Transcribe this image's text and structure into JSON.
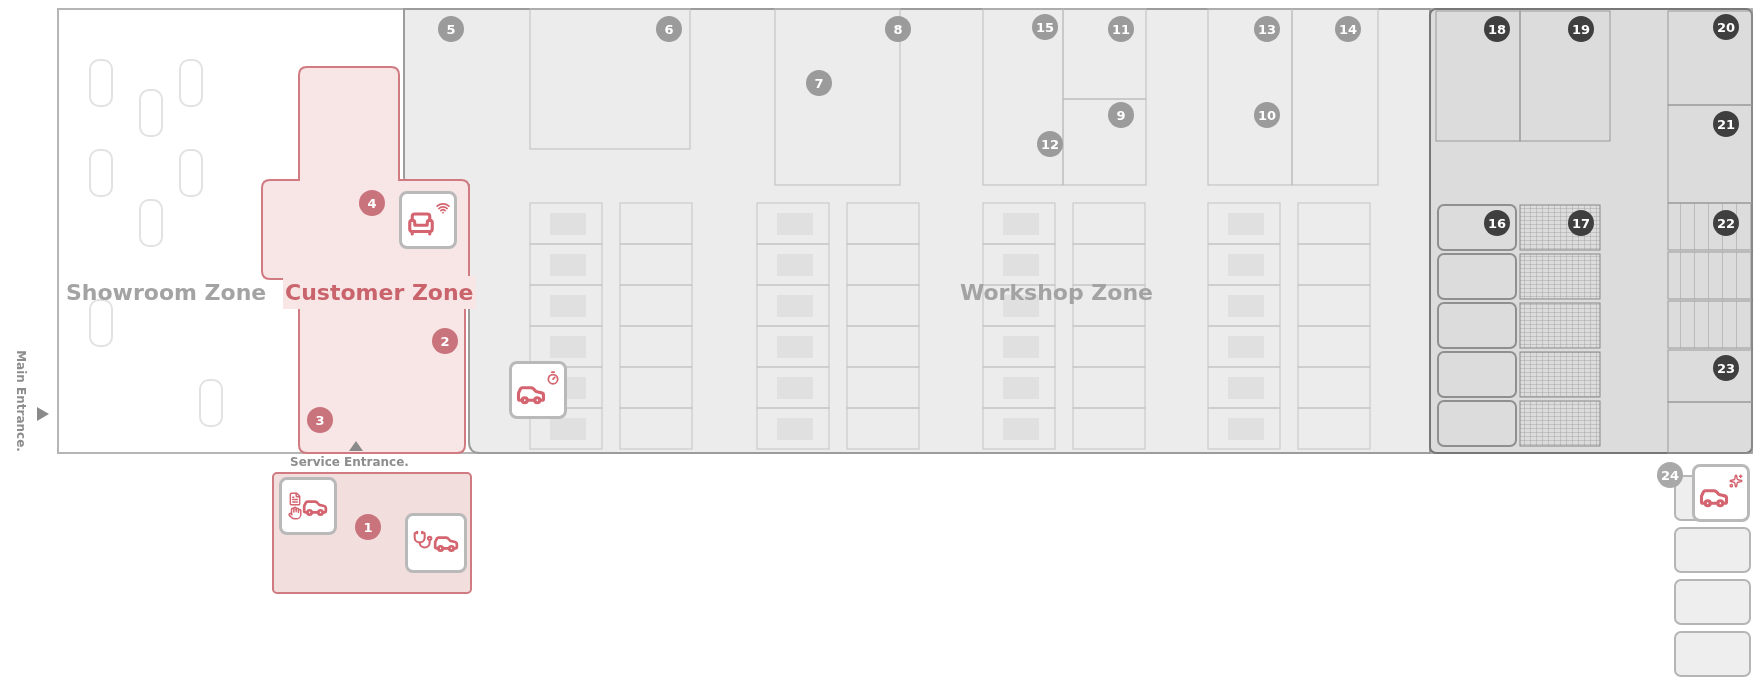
{
  "zones": [
    {
      "kind": "showroom",
      "label": "Showroom Zone"
    },
    {
      "kind": "customer",
      "label": "Customer Zone"
    },
    {
      "kind": "workshop",
      "label": "Workshop Zone"
    }
  ],
  "entrances": [
    {
      "kind": "main",
      "label": "Main Entrance."
    },
    {
      "kind": "service",
      "label": "Service Entrance."
    }
  ],
  "markers": [
    {
      "number": "5",
      "color": "#9b9b9b"
    },
    {
      "number": "6",
      "color": "#9b9b9b"
    },
    {
      "number": "8",
      "color": "#9b9b9b"
    },
    {
      "number": "15",
      "color": "#9b9b9b"
    },
    {
      "number": "11",
      "color": "#9b9b9b"
    },
    {
      "number": "13",
      "color": "#9b9b9b"
    },
    {
      "number": "14",
      "color": "#9b9b9b"
    },
    {
      "number": "18",
      "color": "#3f3f40"
    },
    {
      "number": "19",
      "color": "#3f3f40"
    },
    {
      "number": "20",
      "color": "#3f3f40"
    },
    {
      "number": "7",
      "color": "#9b9b9b"
    },
    {
      "number": "9",
      "color": "#9b9b9b"
    },
    {
      "number": "10",
      "color": "#9b9b9b"
    },
    {
      "number": "21",
      "color": "#3f3f40"
    },
    {
      "number": "12",
      "color": "#9b9b9b"
    },
    {
      "number": "4",
      "color": "#c9737c"
    },
    {
      "number": "16",
      "color": "#3f3f40"
    },
    {
      "number": "17",
      "color": "#3f3f40"
    },
    {
      "number": "22",
      "color": "#3f3f40"
    },
    {
      "number": "2",
      "color": "#c9737c"
    },
    {
      "number": "23",
      "color": "#3f3f40"
    },
    {
      "number": "3",
      "color": "#c9737c"
    },
    {
      "number": "24",
      "color": "#a9a9a9"
    },
    {
      "number": "1",
      "color": "#c9737c"
    }
  ]
}
